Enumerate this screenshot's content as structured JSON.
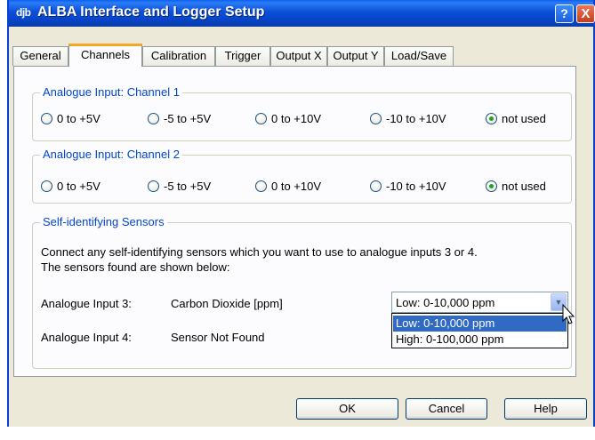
{
  "window": {
    "app_icon_text": "djb",
    "title": "ALBA Interface and Logger Setup",
    "help_label": "?",
    "close_label": "X"
  },
  "tabs": [
    {
      "label": "General"
    },
    {
      "label": "Channels"
    },
    {
      "label": "Calibration"
    },
    {
      "label": "Trigger"
    },
    {
      "label": "Output X"
    },
    {
      "label": "Output Y"
    },
    {
      "label": "Load/Save"
    }
  ],
  "active_tab": "Channels",
  "channel1": {
    "title": "Analogue Input: Channel 1",
    "options": [
      "0 to +5V",
      "-5 to +5V",
      "0 to +10V",
      "-10 to +10V",
      "not used"
    ],
    "selected": "not used"
  },
  "channel2": {
    "title": "Analogue Input: Channel 2",
    "options": [
      "0 to +5V",
      "-5 to +5V",
      "0 to +10V",
      "-10 to +10V",
      "not used"
    ],
    "selected": "not used"
  },
  "sensors": {
    "title": "Self-identifying Sensors",
    "description_line1": "Connect any self-identifying sensors which you want to use to analogue inputs 3 or 4.",
    "description_line2": "The sensors found are shown below:",
    "input3_label": "Analogue Input 3:",
    "input3_value": "Carbon Dioxide [ppm]",
    "input4_label": "Analogue Input 4:",
    "input4_value": "Sensor Not Found",
    "range_selected": "Low: 0-10,000 ppm",
    "range_options": [
      "Low: 0-10,000 ppm",
      "High: 0-100,000 ppm"
    ]
  },
  "buttons": {
    "ok": "OK",
    "cancel": "Cancel",
    "help": "Help"
  },
  "colors": {
    "titlebar": "#0a4fd6",
    "group_title": "#0046d5",
    "radio_checked": "#21a121",
    "selection": "#316ac5",
    "active_tab_accent": "#f5a623"
  }
}
